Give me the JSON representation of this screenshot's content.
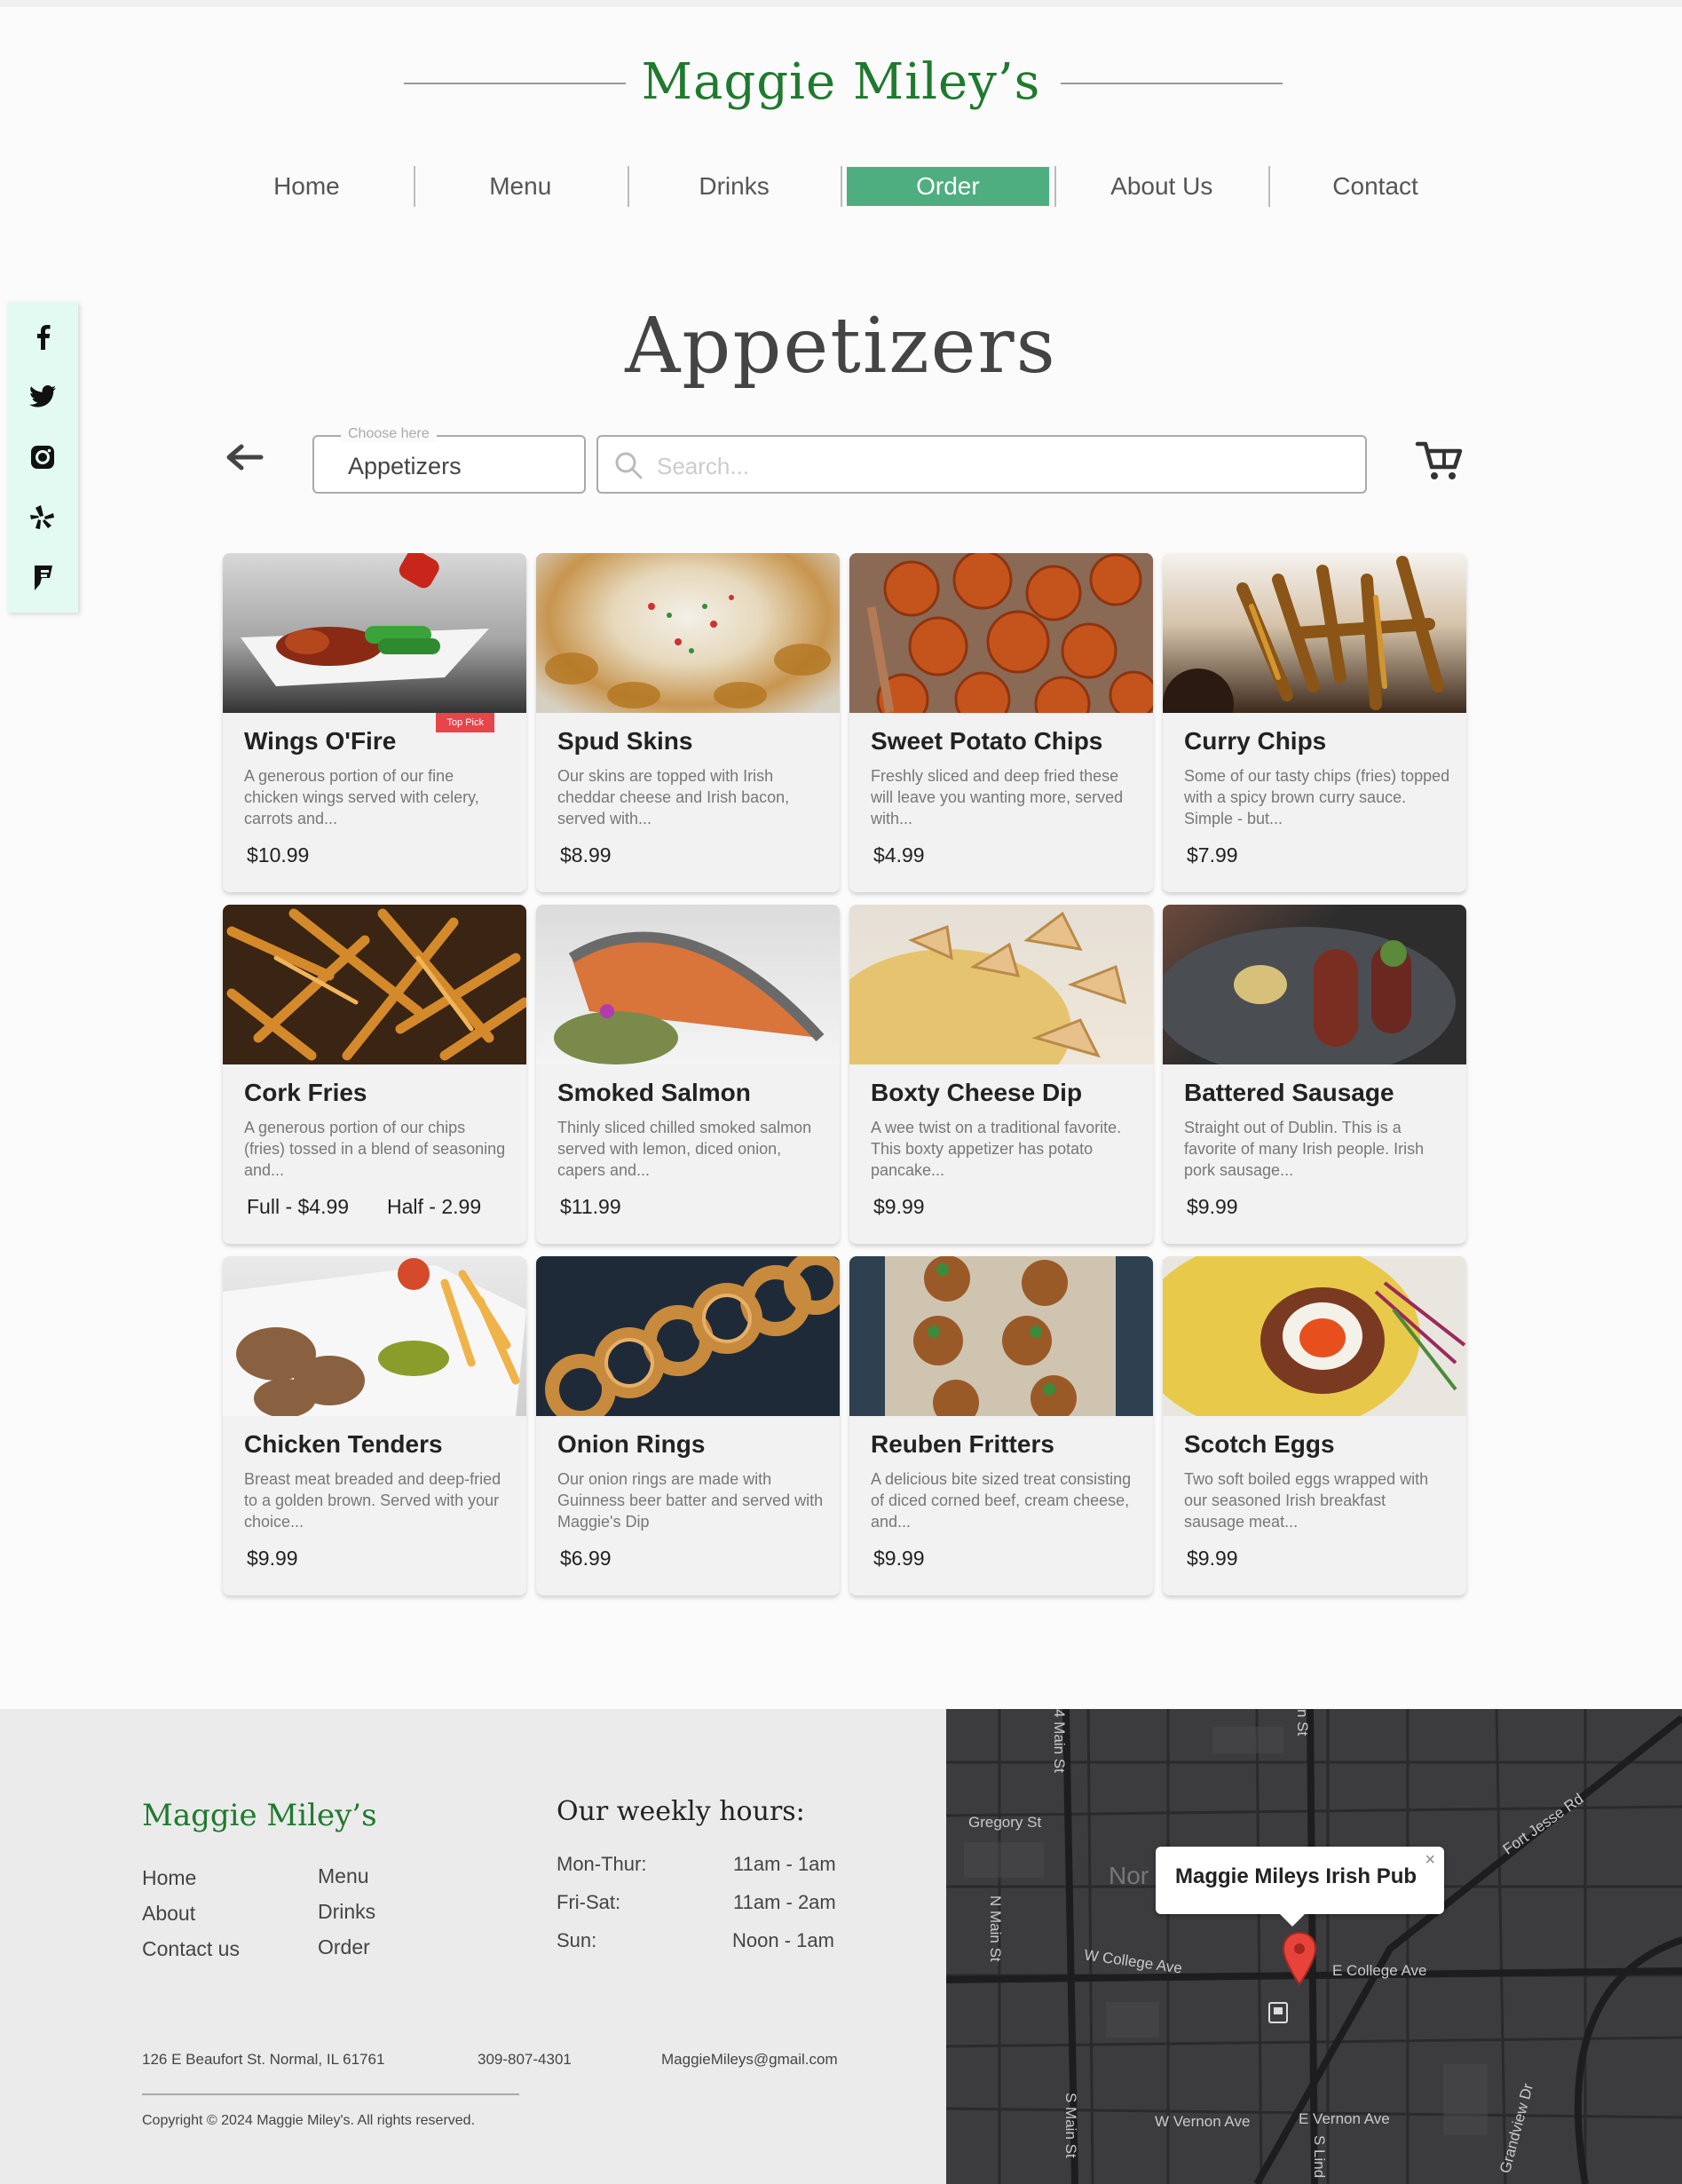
{
  "brand": "Maggie Miley’s",
  "nav": [
    {
      "label": "Home"
    },
    {
      "label": "Menu"
    },
    {
      "label": "Drinks"
    },
    {
      "label": "Order",
      "active": true
    },
    {
      "label": "About Us"
    },
    {
      "label": "Contact"
    }
  ],
  "social": [
    "facebook-icon",
    "twitter-icon",
    "instagram-icon",
    "yelp-icon",
    "foursquare-icon"
  ],
  "page_title": "Appetizers",
  "controls": {
    "category_label": "Choose here",
    "category_value": "Appetizers",
    "search_placeholder": "Search..."
  },
  "items": [
    {
      "name": "Wings O'Fire",
      "desc": "A generous portion of our fine chicken wings served with celery, carrots and...",
      "price": "$10.99",
      "badge": "Top Pick"
    },
    {
      "name": "Spud Skins",
      "desc": "Our skins are topped with Irish cheddar cheese and Irish bacon, served with...",
      "price": "$8.99"
    },
    {
      "name": "Sweet Potato Chips",
      "desc": "Freshly sliced and deep fried these will leave you wanting more, served with...",
      "price": "$4.99"
    },
    {
      "name": "Curry Chips",
      "desc": "Some of our tasty chips (fries) topped with a spicy brown curry sauce. Simple - but...",
      "price": "$7.99"
    },
    {
      "name": "Cork Fries",
      "desc": "A generous portion of our chips (fries) tossed in a blend of seasoning and...",
      "price": "Full - $4.99",
      "price2": "Half - 2.99"
    },
    {
      "name": "Smoked Salmon",
      "desc": "Thinly sliced chilled smoked salmon served with lemon, diced onion, capers and...",
      "price": "$11.99"
    },
    {
      "name": "Boxty Cheese Dip",
      "desc": "A wee twist on a traditional favorite.  This boxty appetizer has potato pancake...",
      "price": "$9.99"
    },
    {
      "name": "Battered Sausage",
      "desc": "Straight out of Dublin. This is a favorite of many Irish people. Irish pork sausage...",
      "price": "$9.99"
    },
    {
      "name": "Chicken Tenders",
      "desc": "Breast meat breaded and deep-fried to a golden brown. Served with your choice...",
      "price": "$9.99"
    },
    {
      "name": "Onion Rings",
      "desc": "Our onion rings are made with Guinness beer batter and served with Maggie's Dip",
      "price": "$6.99"
    },
    {
      "name": "Reuben Fritters",
      "desc": "A delicious bite sized treat consisting of diced corned beef, cream cheese, and...",
      "price": "$9.99"
    },
    {
      "name": "Scotch Eggs",
      "desc": "Two soft boiled eggs wrapped with our seasoned Irish breakfast sausage meat...",
      "price": "$9.99"
    }
  ],
  "footer": {
    "brand": "Maggie Miley’s",
    "links": [
      "Home",
      "Menu",
      "About",
      "Drinks",
      "Contact us",
      "Order"
    ],
    "hours_title": "Our weekly hours:",
    "hours": [
      {
        "day": "Mon-Thur:",
        "time": "11am - 1am"
      },
      {
        "day": "Fri-Sat:",
        "time": "11am - 2am"
      },
      {
        "day": "Sun:",
        "time": "Noon - 1am"
      }
    ],
    "address": "126 E Beaufort St. Normal, IL 61761",
    "phone": "309-807-4301",
    "email": "MaggieMileys@gmail.com",
    "copyright": "Copyright © 2024 Maggie Miley's. All rights reserved."
  },
  "map": {
    "popup_title": "Maggie Mileys Irish Pub",
    "close": "×",
    "streets": [
      "Gregory St",
      "N Main St",
      "Fort Jesse Rd",
      "W College Ave",
      "E College Ave",
      "W Vernon Ave",
      "E Vernon Ave",
      "S Main St",
      "Grandview Dr",
      "Nor",
      "4 Main St",
      "n St",
      "S Lind"
    ]
  }
}
